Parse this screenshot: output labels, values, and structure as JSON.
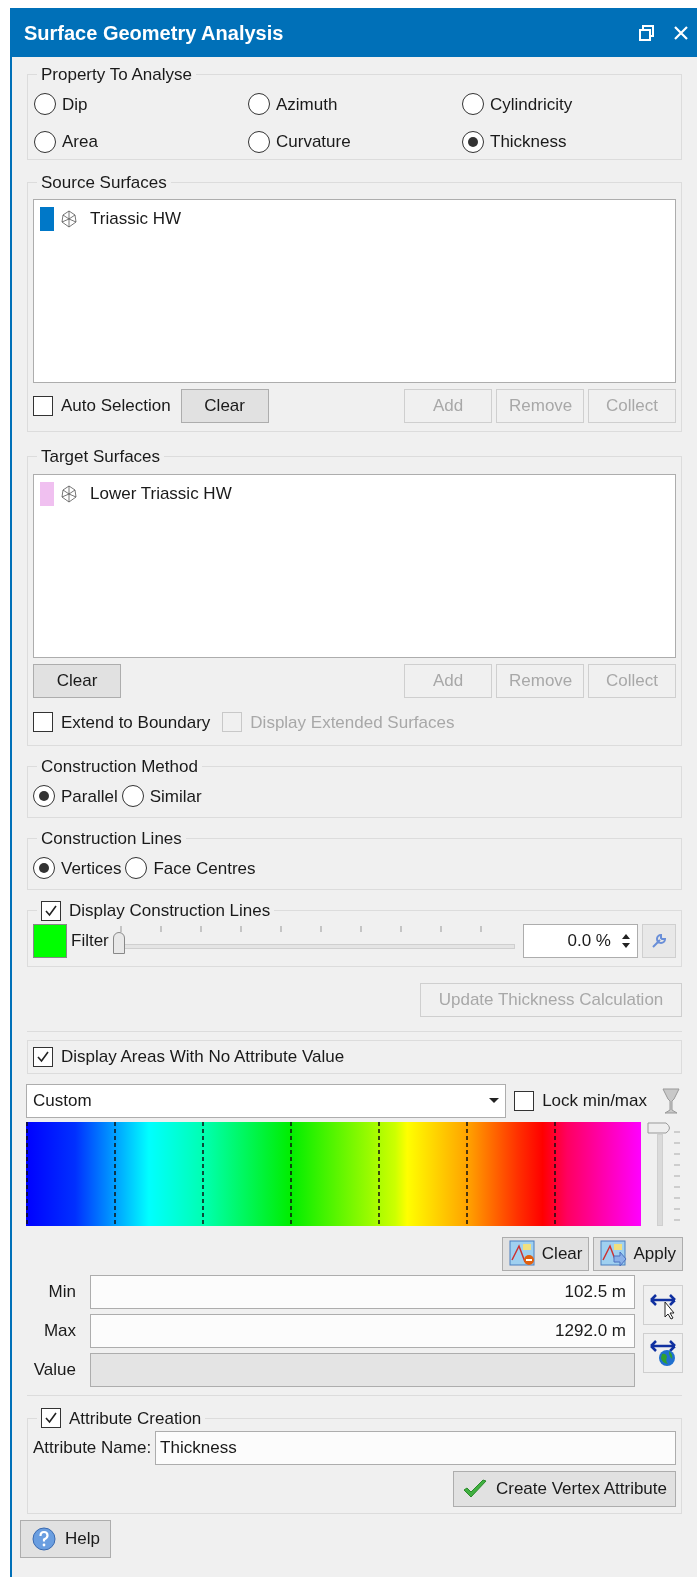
{
  "window": {
    "title": "Surface Geometry Analysis"
  },
  "property_to_analyse": {
    "label": "Property To Analyse",
    "options": [
      {
        "label": "Dip",
        "selected": false
      },
      {
        "label": "Azimuth",
        "selected": false
      },
      {
        "label": "Cylindricity",
        "selected": false
      },
      {
        "label": "Area",
        "selected": false
      },
      {
        "label": "Curvature",
        "selected": false
      },
      {
        "label": "Thickness",
        "selected": true
      }
    ]
  },
  "source_surfaces": {
    "label": "Source Surfaces",
    "items": [
      {
        "name": "Triassic HW",
        "color": "#0078c8"
      }
    ],
    "auto_selection": {
      "label": "Auto Selection",
      "checked": false
    },
    "buttons": [
      {
        "label": "Clear",
        "disabled": false
      },
      {
        "label": "Add",
        "disabled": true
      },
      {
        "label": "Remove",
        "disabled": true
      },
      {
        "label": "Collect",
        "disabled": true
      }
    ]
  },
  "target_surfaces": {
    "label": "Target Surfaces",
    "items": [
      {
        "name": "Lower Triassic HW",
        "color": "#f0c0f0"
      }
    ],
    "buttons": [
      {
        "label": "Clear",
        "disabled": false
      },
      {
        "label": "Add",
        "disabled": true
      },
      {
        "label": "Remove",
        "disabled": true
      },
      {
        "label": "Collect",
        "disabled": true
      }
    ],
    "options": [
      {
        "label": "Extend to Boundary",
        "checked": false,
        "disabled": false
      },
      {
        "label": "Display Extended Surfaces",
        "checked": false,
        "disabled": true
      }
    ]
  },
  "construction_method": {
    "label": "Construction Method",
    "options": [
      {
        "label": "Parallel",
        "selected": true
      },
      {
        "label": "Similar",
        "selected": false
      }
    ]
  },
  "construction_lines": {
    "label": "Construction Lines",
    "options": [
      {
        "label": "Vertices",
        "selected": true
      },
      {
        "label": "Face Centres",
        "selected": false
      }
    ]
  },
  "display_construction_lines": {
    "label": "Display Construction Lines",
    "checked": true,
    "filter": {
      "label": "Filter",
      "color": "#00ff00",
      "level": 0,
      "value": "0.0 %"
    }
  },
  "update_button": {
    "label": "Update Thickness Calculation",
    "disabled": true
  },
  "display_no_value": {
    "label": "Display Areas With No Attribute Value",
    "checked": true
  },
  "colormap": {
    "preset": "Custom",
    "range_slider": {
      "level": 1
    },
    "lock": {
      "label": "Lock min/max",
      "checked": false
    },
    "clear": "Clear",
    "apply": "Apply",
    "fields": [
      {
        "label": "Min",
        "value": "102.5 m",
        "disabled": false
      },
      {
        "label": "Max",
        "value": "1292.0 m",
        "disabled": false
      },
      {
        "label": "Value",
        "disabled": true
      }
    ]
  },
  "attribute_creation": {
    "label": "Attribute Creation",
    "checked": true,
    "name_label": "Attribute Name:",
    "name_value": "Thickness",
    "button": "Create Vertex Attribute"
  },
  "help": "Help"
}
